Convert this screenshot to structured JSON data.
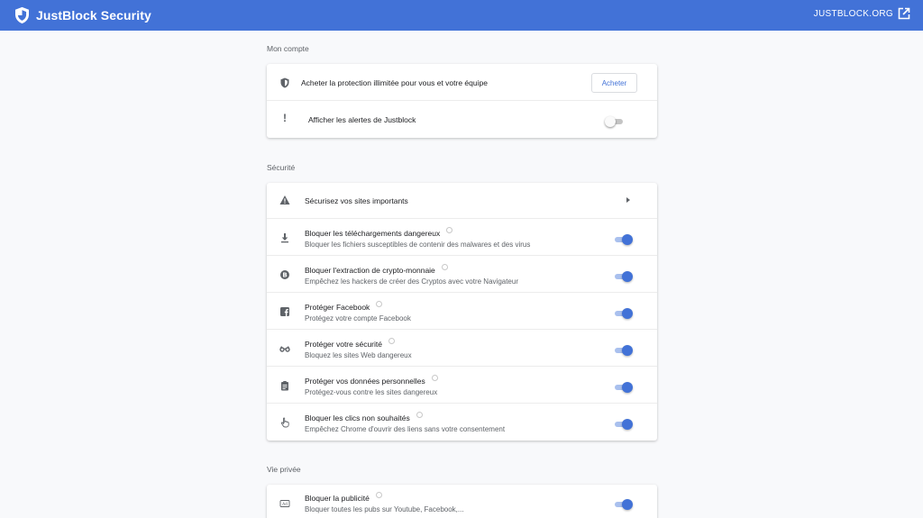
{
  "header": {
    "title": "JustBlock Security",
    "link_label": "JUSTBLOCK.ORG",
    "color": "#4272d7"
  },
  "account": {
    "section_title": "Mon compte",
    "buy_row": {
      "icon": "shield-icon",
      "title": "Acheter la protection illimitée pour vous et votre équipe",
      "button_label": "Acheter"
    },
    "alerts_row": {
      "icon": "exclamation-icon",
      "title": "Afficher les alertes de Justblock",
      "enabled": false
    }
  },
  "security": {
    "section_title": "Sécurité",
    "important_row": {
      "icon": "warning-icon",
      "title": "Sécurisez vos sites importants"
    },
    "items": [
      {
        "icon": "download-icon",
        "title": "Bloquer les téléchargements dangereux",
        "subtitle": "Bloquer les fichiers susceptibles de contenir des malwares et des virus",
        "enabled": true
      },
      {
        "icon": "bitcoin-icon",
        "title": "Bloquer l'extraction de crypto-monnaie",
        "subtitle": "Empêchez les hackers de créer des Cryptos avec votre Navigateur",
        "enabled": true
      },
      {
        "icon": "facebook-icon",
        "title": "Protéger Facebook",
        "subtitle": "Protégez votre compte Facebook",
        "enabled": true
      },
      {
        "icon": "glasses-icon",
        "title": "Protéger votre sécurité",
        "subtitle": "Bloquez les sites Web dangereux",
        "enabled": true
      },
      {
        "icon": "clipboard-icon",
        "title": "Protéger vos données personnelles",
        "subtitle": "Protégez-vous contre les sites dangereux",
        "enabled": true
      },
      {
        "icon": "pointer-hand-icon",
        "title": "Bloquer les clics non souhaités",
        "subtitle": "Empêchez Chrome d'ouvrir des liens sans votre consentement",
        "enabled": true
      }
    ]
  },
  "privacy": {
    "section_title": "Vie privée",
    "items": [
      {
        "icon": "ad-icon",
        "title": "Bloquer la publicité",
        "subtitle": "Bloquer toutes les pubs sur Youtube, Facebook,...",
        "enabled": true
      }
    ]
  }
}
